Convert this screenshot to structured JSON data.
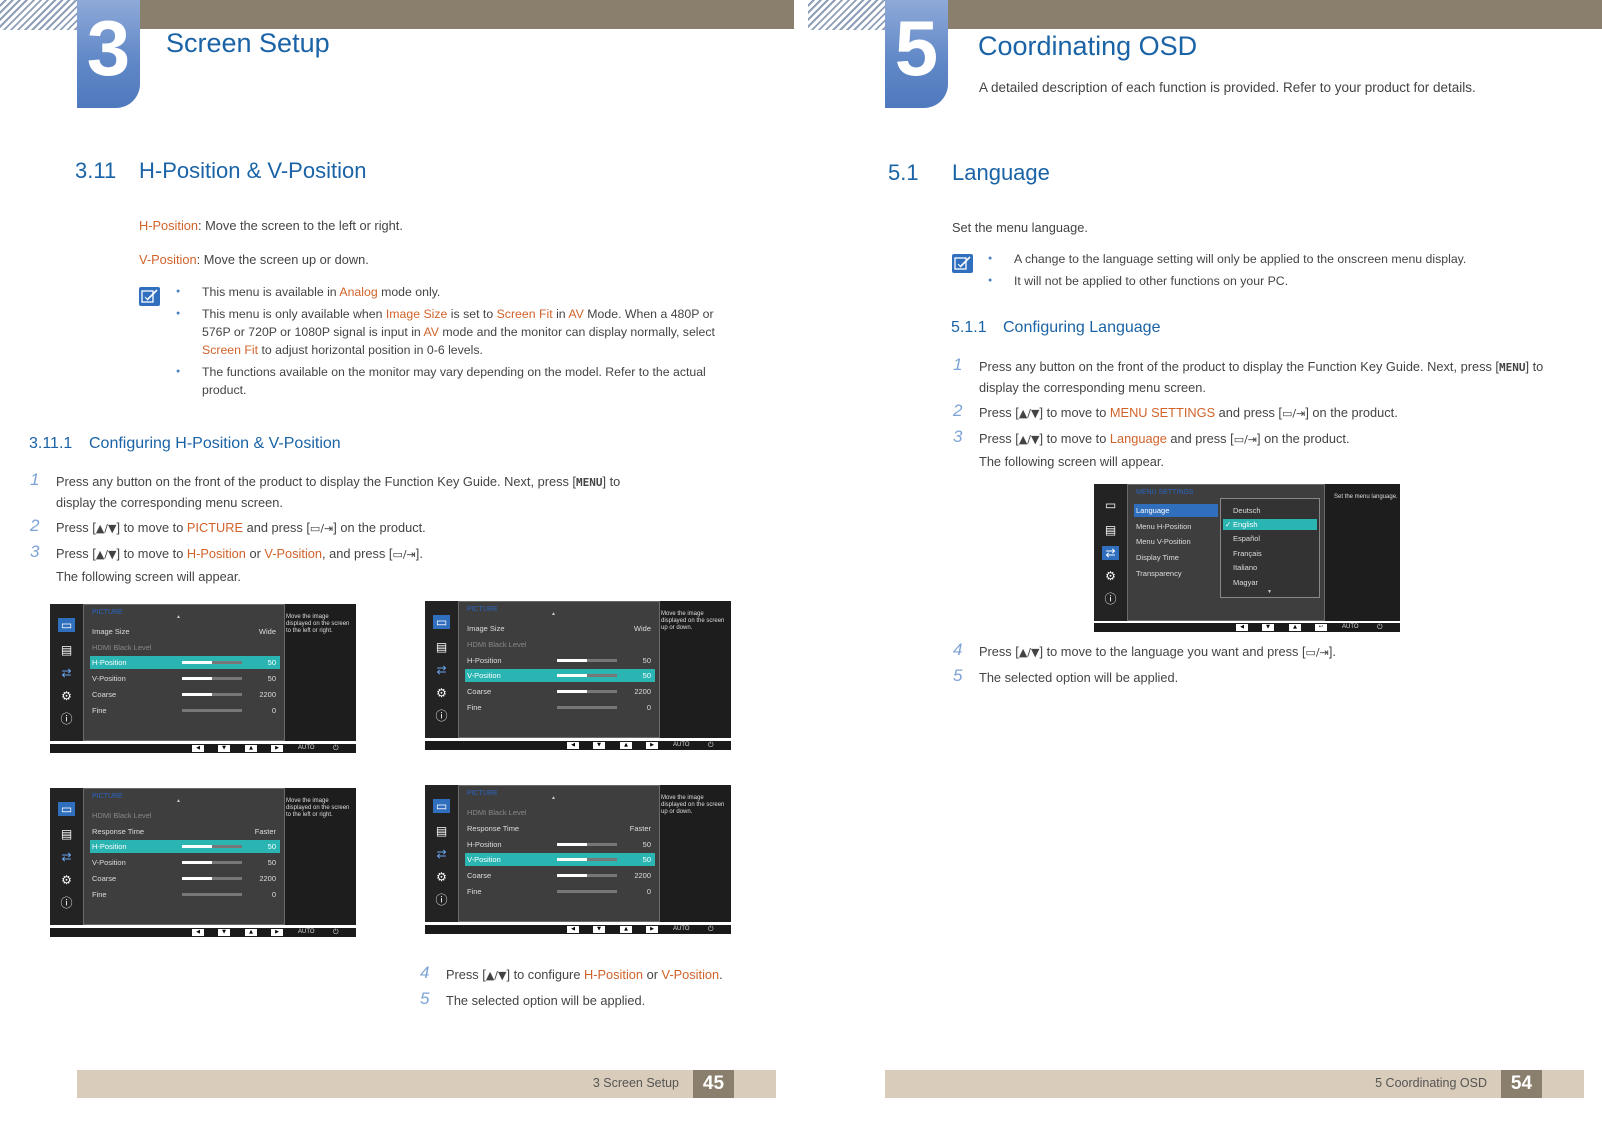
{
  "left": {
    "chapter_number": "3",
    "chapter_title": "Screen Setup",
    "section": {
      "num": "3.11",
      "title": "H-Position & V-Position"
    },
    "desc": [
      {
        "term": "H-Position",
        "text": ": Move the screen to the left or right."
      },
      {
        "term": "V-Position",
        "text": ": Move the screen up or down."
      }
    ],
    "notes": {
      "n1_a": "This menu is available in ",
      "n1_b": "Analog",
      "n1_c": " mode only.",
      "n2_a": "This menu is only available when ",
      "n2_b": "Image Size",
      "n2_c": " is set to ",
      "n2_d": "Screen Fit",
      "n2_e": " in ",
      "n2_f": "AV",
      "n2_g": " Mode. When a 480P or 576P or 720P or 1080P signal is input in ",
      "n2_h": "AV",
      "n2_i": " mode and the monitor can display normally, select ",
      "n2_j": "Screen Fit",
      "n2_k": " to adjust horizontal position in 0-6 levels.",
      "n3": "The functions available on the monitor may vary depending on the model. Refer to the actual product."
    },
    "subsection": {
      "num": "3.11.1",
      "title": "Configuring H-Position & V-Position"
    },
    "steps": {
      "s1_n": "1",
      "s1_a": "Press any button on the front of the product to display the Function Key Guide. Next, press [",
      "s1_menu": "MENU",
      "s1_b": "] to display the corresponding menu screen.",
      "s2_n": "2",
      "s2_a": "Press [",
      "s2_b": "] to move to ",
      "s2_c": "PICTURE",
      "s2_d": " and press [",
      "s2_e": "] on the product.",
      "s3_n": "3",
      "s3_a": "Press [",
      "s3_b": "] to move to ",
      "s3_c": "H-Position",
      "s3_d": " or ",
      "s3_e": "V-Position",
      "s3_f": ", and press [",
      "s3_g": "].",
      "s3_after": "The following screen will appear.",
      "s4_n": "4",
      "s4_a": "Press [",
      "s4_b": "] to configure ",
      "s4_c": "H-Position",
      "s4_d": " or ",
      "s4_e": "V-Position",
      "s4_f": ".",
      "s5_n": "5",
      "s5_a": "The selected option will be applied."
    },
    "osd": {
      "title": "PICTURE",
      "image_size": "Image Size",
      "wide": "Wide",
      "hdmi_black": "HDMI Black Level",
      "response_time": "Response Time",
      "faster": "Faster",
      "h_position": "H-Position",
      "v_position": "V-Position",
      "coarse": "Coarse",
      "fine": "Fine",
      "v50": "50",
      "v2200": "2200",
      "v0": "0",
      "help_h": "Move the image displayed on the screen to the left or right.",
      "help_v": "Move the image displayed on the screen up or down.",
      "auto": "AUTO"
    },
    "footer": {
      "text": "3 Screen Setup",
      "page": "45"
    }
  },
  "right": {
    "chapter_number": "5",
    "chapter_title": "Coordinating OSD",
    "chapter_sub": "A detailed description of each function is provided. Refer to your product for details.",
    "section": {
      "num": "5.1",
      "title": "Language"
    },
    "intro": "Set the menu language.",
    "notes": {
      "n1": "A change to the language setting will only be applied to the onscreen menu display.",
      "n2": "It will not be applied to other functions on your PC."
    },
    "subsection": {
      "num": "5.1.1",
      "title": "Configuring Language"
    },
    "steps": {
      "s1_n": "1",
      "s1_a": "Press any button on the front of the product to display the Function Key Guide. Next, press [",
      "s1_menu": "MENU",
      "s1_b": "] to display the corresponding menu screen.",
      "s2_n": "2",
      "s2_a": "Press [",
      "s2_b": "] to move to ",
      "s2_c": "MENU SETTINGS",
      "s2_d": " and press [",
      "s2_e": "] on the product.",
      "s3_n": "3",
      "s3_a": "Press [",
      "s3_b": "] to move to ",
      "s3_c": "Language",
      "s3_d": " and press [",
      "s3_e": "] on the product.",
      "s3_after": "The following screen will appear.",
      "s4_n": "4",
      "s4_a": "Press [",
      "s4_b": "] to move to the language you want and press [",
      "s4_c": "].",
      "s5_n": "5",
      "s5_a": "The selected option will be applied."
    },
    "osd": {
      "title": "MENU SETTINGS",
      "items": [
        "Language",
        "Menu H-Position",
        "Menu V-Position",
        "Display Time",
        "Transparency"
      ],
      "langs": [
        "Deutsch",
        "English",
        "Español",
        "Français",
        "Italiano",
        "Magyar"
      ],
      "help": "Set the menu language.",
      "auto": "AUTO"
    },
    "footer": {
      "text": "5 Coordinating OSD",
      "page": "54"
    }
  },
  "glyphs": {
    "updown": "▲/▼",
    "enter": "▭/⇥"
  },
  "colors": {
    "heading_blue": "#1a63a6",
    "highlight_orange": "#d0622a",
    "osd_select": "#2ab4b2",
    "top_bar": "#8a7e6c",
    "footer_bar": "#d9ccba"
  }
}
